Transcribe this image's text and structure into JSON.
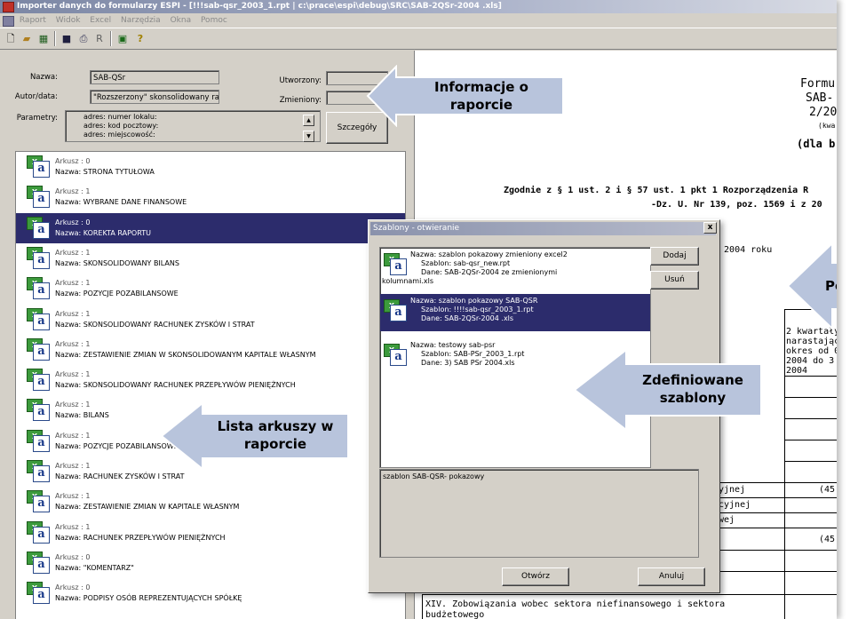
{
  "window": {
    "title": "Importer danych do formularzy ESPI - [!!!sab-qsr_2003_1.rpt | c:\\prace\\espi\\debug\\SRC\\SAB-2QSr-2004 .xls]"
  },
  "menu": [
    "Raport",
    "Widok",
    "Excel",
    "Narzędzia",
    "Okna",
    "Pomoc"
  ],
  "toolbar": {
    "icons": [
      "new-icon",
      "open-icon",
      "save-icon",
      "print-icon",
      "report-icon",
      "excel-icon",
      "help-icon"
    ],
    "report_letter": "R"
  },
  "properties": {
    "name_label": "Nazwa:",
    "name_value": "SAB-QSr",
    "author_label": "Autor/data:",
    "author_value": "\"Rozszerzony\" skonsolidowany rap",
    "created_label": "Utworzony:",
    "created_value": "",
    "modified_label": "Zmieniony:",
    "modified_value": "",
    "params_label": "Parametry:",
    "params": [
      "adres: numer lokalu:",
      "adres: kod pocztowy:",
      "adres: miejscowość:"
    ],
    "details_button": "Szczegóły"
  },
  "sheets": [
    {
      "sheet": "Arkusz : 0",
      "name": "Nazwa: STRONA TYTUŁOWA"
    },
    {
      "sheet": "Arkusz : 1",
      "name": "Nazwa: WYBRANE DANE FINANSOWE"
    },
    {
      "sheet": "Arkusz : 0",
      "name": "Nazwa: KOREKTA RAPORTU"
    },
    {
      "sheet": "Arkusz : 1",
      "name": "Nazwa: SKONSOLIDOWANY BILANS"
    },
    {
      "sheet": "Arkusz : 1",
      "name": "Nazwa: POZYCJE POZABILANSOWE"
    },
    {
      "sheet": "Arkusz : 1",
      "name": "Nazwa: SKONSOLIDOWANY RACHUNEK ZYSKÓW I STRAT"
    },
    {
      "sheet": "Arkusz : 1",
      "name": "Nazwa: ZESTAWIENIE ZMIAN W SKONSOLIDOWANYM KAPITALE WŁASNYM"
    },
    {
      "sheet": "Arkusz : 1",
      "name": "Nazwa: SKONSOLIDOWANY RACHUNEK PRZEPŁYWÓW  PIENIĘŻNYCH"
    },
    {
      "sheet": "Arkusz : 1",
      "name": "Nazwa: BILANS"
    },
    {
      "sheet": "Arkusz : 1",
      "name": "Nazwa: POZYCJE POZABILANSOWE"
    },
    {
      "sheet": "Arkusz : 1",
      "name": "Nazwa: RACHUNEK ZYSKÓW I STRAT"
    },
    {
      "sheet": "Arkusz : 1",
      "name": "Nazwa: ZESTAWIENIE ZMIAN W KAPITALE WŁASNYM"
    },
    {
      "sheet": "Arkusz : 1",
      "name": "Nazwa: RACHUNEK PRZEPŁYWÓW  PIENIĘŻNYCH"
    },
    {
      "sheet": "Arkusz : 0",
      "name": "Nazwa: \"KOMENTARZ\""
    },
    {
      "sheet": "Arkusz : 0",
      "name": "Nazwa: PODPISY OSÓB REPREZENTUJĄCYCH SPÓŁKĘ"
    }
  ],
  "selected_sheet_index": 2,
  "document": {
    "title1": "Formu",
    "title2": "SAB-",
    "title3": "2/20",
    "title4": "(kwa",
    "title5": "(dla b",
    "law1": "Zgodnie z § 1 ust. 2 i § 57 ust. 1 pkt 1 Rozporządzenia R",
    "law2": "-Dz. U. Nr 139, poz. 1569 i z 20",
    "year_text": "ł  2004 roku",
    "col1": "2 kwartały",
    "col2": "narastając",
    "col3": "okres od 0",
    "col4": "2004 do 3",
    "col5": "2004",
    "row_a": "yjnej",
    "row_a_val": "(45",
    "row_b": "cyjnej",
    "row_c": "wej",
    "row_c_val": "(45:",
    "footer1": "XIV. Zobowiązania wobec sektora niefinansowego i sektora",
    "footer2": "budżetowego"
  },
  "dialog": {
    "title": "Szablony - otwieranie",
    "close": "x",
    "templates": [
      {
        "name": "Nazwa: szablon pokazowy  zmieniony excel2",
        "template": "Szablon: sab-qsr_new.rpt",
        "data": "Dane: SAB-2QSr-2004 ze zmienionymi",
        "data_cont": "kolumnami.xls"
      },
      {
        "name": "Nazwa: szablon pokazowy SAB-QSR",
        "template": "Szablon: !!!!sab-qsr_2003_1.rpt",
        "data": "Dane: SAB-2QSr-2004 .xls",
        "data_cont": ""
      },
      {
        "name": "Nazwa: testowy sab-psr",
        "template": "Szablon: SAB-PSr_2003_1.rpt",
        "data": "Dane: 3) SAB PSr 2004.xls",
        "data_cont": ""
      }
    ],
    "selected_index": 1,
    "add_button": "Dodaj",
    "remove_button": "Usuń",
    "description": "szablon SAB-QSR- pokazowy",
    "open_button": "Otwórz",
    "cancel_button": "Anuluj"
  },
  "callouts": {
    "report_info": [
      "Informacje o",
      "raporcie"
    ],
    "sheet_list": [
      "Lista arkuszy w",
      "raporcie"
    ],
    "templates": [
      "Zdefiniowane",
      "szablony"
    ],
    "right_partial": "Po"
  },
  "colors": {
    "selection": "#2c2c6c",
    "callout_fill": "#b8c4dc",
    "window_bg": "#d4d0c8"
  }
}
